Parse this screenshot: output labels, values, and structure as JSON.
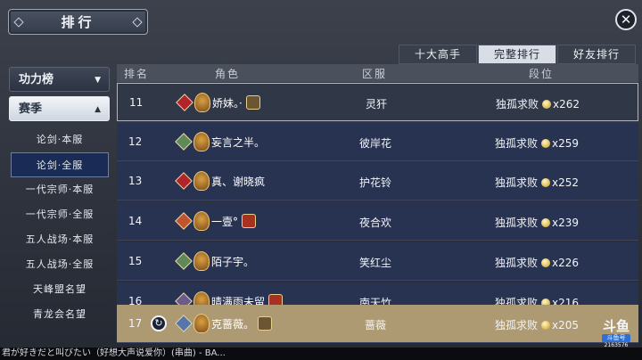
{
  "header": {
    "title": "排行"
  },
  "tabs": [
    {
      "label": "十大高手",
      "active": false
    },
    {
      "label": "完整排行",
      "active": true
    },
    {
      "label": "好友排行",
      "active": false
    }
  ],
  "sidebar": {
    "power_label": "功力榜",
    "season_label": "赛季",
    "items": [
      {
        "label": "论剑·本服",
        "active": false
      },
      {
        "label": "论剑·全服",
        "active": true
      },
      {
        "label": "一代宗师·本服",
        "active": false
      },
      {
        "label": "一代宗师·全服",
        "active": false
      },
      {
        "label": "五人战场·本服",
        "active": false
      },
      {
        "label": "五人战场·全服",
        "active": false
      },
      {
        "label": "天峰盟名望",
        "active": false
      },
      {
        "label": "青龙会名望",
        "active": false
      }
    ]
  },
  "table": {
    "headers": [
      "排名",
      "角色",
      "区服",
      "段位"
    ],
    "rows": [
      {
        "rank": "11",
        "name": "娇妹。·",
        "server": "灵犴",
        "tier": "独孤求败",
        "count": "x262",
        "badge": "#b3242a",
        "selected": true
      },
      {
        "rank": "12",
        "name": "妄言之半。",
        "server": "彼岸花",
        "tier": "独孤求败",
        "count": "x259",
        "badge": "#5f8a57"
      },
      {
        "rank": "13",
        "name": "真、谢晓疯",
        "server": "护花铃",
        "tier": "独孤求败",
        "count": "x252",
        "badge": "#b3242a"
      },
      {
        "rank": "14",
        "name": "一壹°",
        "server": "夜合欢",
        "tier": "独孤求败",
        "count": "x239",
        "badge": "#c0542c"
      },
      {
        "rank": "15",
        "name": "陌子宇。",
        "server": "笑红尘",
        "tier": "独孤求败",
        "count": "x226",
        "badge": "#5f8a57"
      },
      {
        "rank": "16",
        "name": "晴满雨未留",
        "server": "南天竹",
        "tier": "独孤求败",
        "count": "x216",
        "badge": "#6b5a8c"
      }
    ],
    "mine": {
      "rank": "17",
      "name": "克蔷薇。",
      "server": "蔷薇",
      "tier": "独孤求败",
      "count": "x205",
      "badge": "#5576a8"
    }
  },
  "watermark": {
    "logo": "斗鱼",
    "sub": "斗鱼号",
    "id": "2163576"
  },
  "ticker": "君が好きだと叫びたい（好想大声说爱你）(串曲)  - BA..."
}
